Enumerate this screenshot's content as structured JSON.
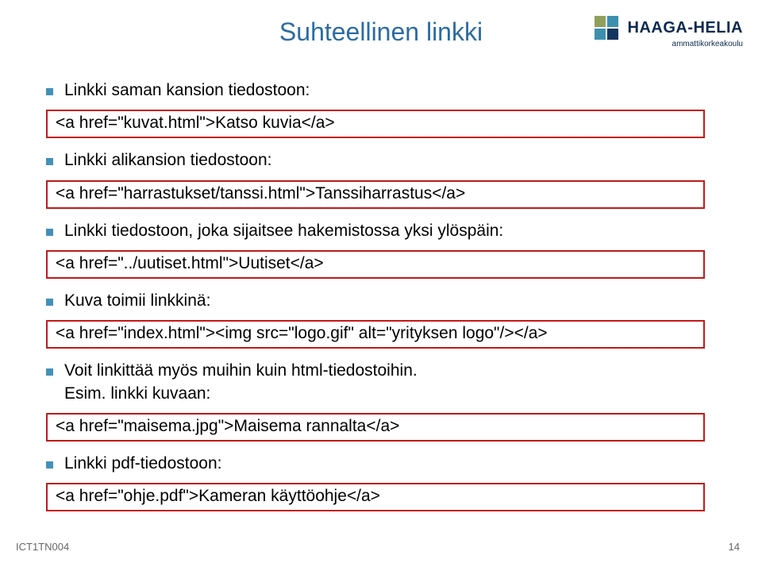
{
  "logo": {
    "name": "HAAGA-HELIA",
    "subtitle": "ammattikorkeakoulu"
  },
  "title": "Suhteellinen linkki",
  "bullets": [
    {
      "text": "Linkki saman kansion tiedostoon:",
      "code": "<a href=\"kuvat.html\">Katso kuvia</a>"
    },
    {
      "text": "Linkki alikansion tiedostoon:",
      "code": "<a href=\"harrastukset/tanssi.html\">Tanssiharrastus</a>"
    },
    {
      "text": "Linkki tiedostoon, joka sijaitsee hakemistossa yksi ylöspäin:",
      "code": "<a href=\"../uutiset.html\">Uutiset</a>"
    },
    {
      "text": "Kuva toimii linkkinä:",
      "code": "<a href=\"index.html\"><img src=\"logo.gif\" alt=\"yrityksen logo\"/></a>"
    },
    {
      "text": "Voit linkittää myös muihin kuin html-tiedostoihin.\nEsim. linkki kuvaan:",
      "code": "<a href=\"maisema.jpg\">Maisema rannalta</a>"
    },
    {
      "text": "Linkki pdf-tiedostoon:",
      "code": "<a href=\"ohje.pdf\">Kameran käyttöohje</a>"
    }
  ],
  "footer": {
    "left": "ICT1TN004",
    "right": "14"
  }
}
